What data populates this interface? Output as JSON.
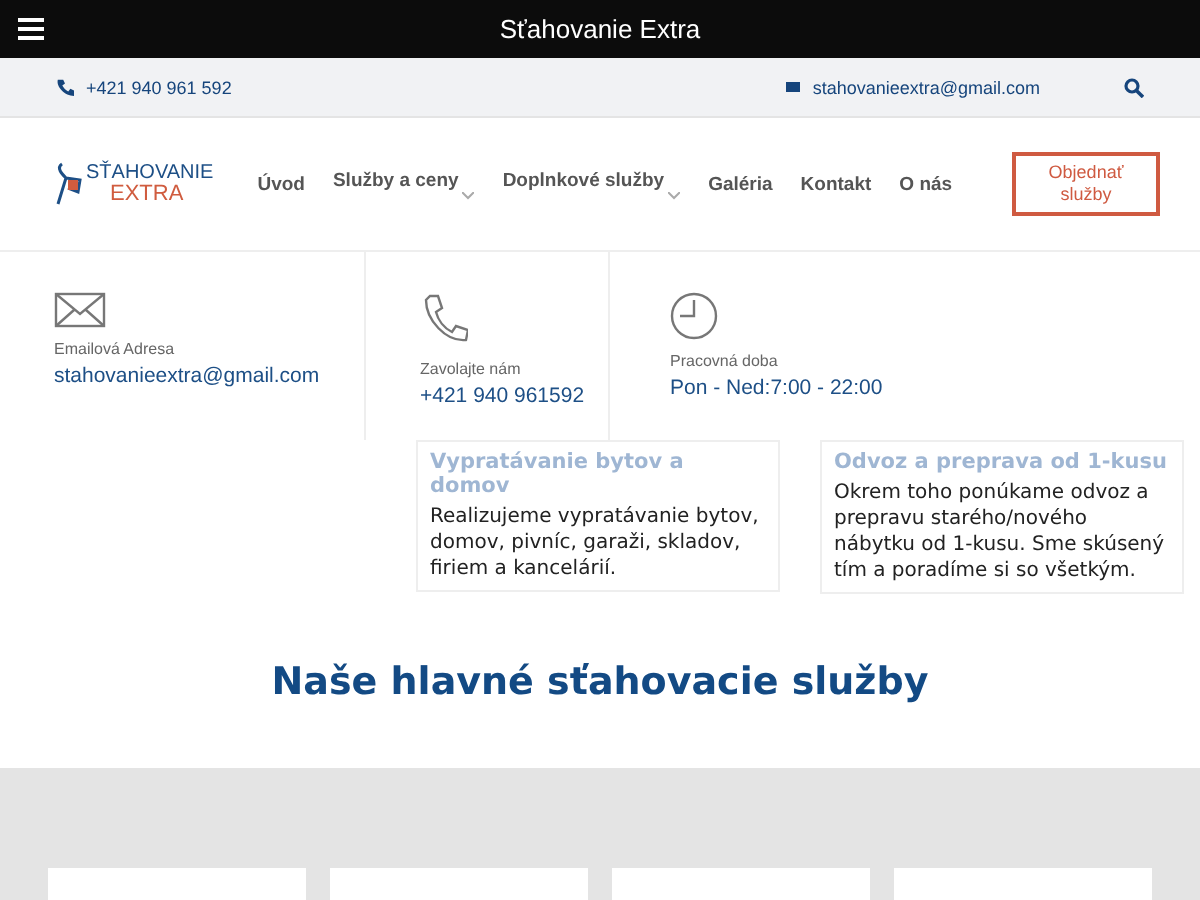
{
  "top_bar": {
    "title": "Sťahovanie Extra"
  },
  "info_bar": {
    "phone": "+421 940 961 592",
    "email": "stahovanieextra@gmail.com"
  },
  "logo": {
    "line_1": "SŤAHOVANIE",
    "line_2": "EXTRA"
  },
  "nav": [
    {
      "label": "Úvod",
      "dropdown": false
    },
    {
      "label": "Služby a ceny",
      "dropdown": true
    },
    {
      "label": "Doplnkové služby",
      "dropdown": true
    },
    {
      "label": "Galéria",
      "dropdown": false
    },
    {
      "label": "Kontakt",
      "dropdown": false
    },
    {
      "label": "O nás",
      "dropdown": false
    }
  ],
  "order_button": "Objednať služby",
  "contacts": [
    {
      "kind": "mail",
      "label": "Emailová Adresa",
      "value": "stahovanieextra@gmail.com"
    },
    {
      "kind": "phone",
      "label": "Zavolajte nám",
      "value": "+421 940 961592"
    },
    {
      "kind": "clock",
      "label": "Pracovná doba",
      "value": "Pon - Ned:7:00 - 22:00"
    }
  ],
  "service_cards": [
    {
      "title": "Vypratávanie bytov a domov",
      "text": "Realizujeme vypratávanie bytov, domov, pivníc, garaži, skladov, firiem a kancelárií."
    },
    {
      "title": "Odvoz a preprava od 1-kusu",
      "text": "Okrem toho ponúkame odvoz a prepravu starého/nového nábytku od 1-kusu. Sme skúsený tím a poradíme si so všetkým."
    }
  ],
  "section_heading": "Naše hlavné sťahovacie služby"
}
